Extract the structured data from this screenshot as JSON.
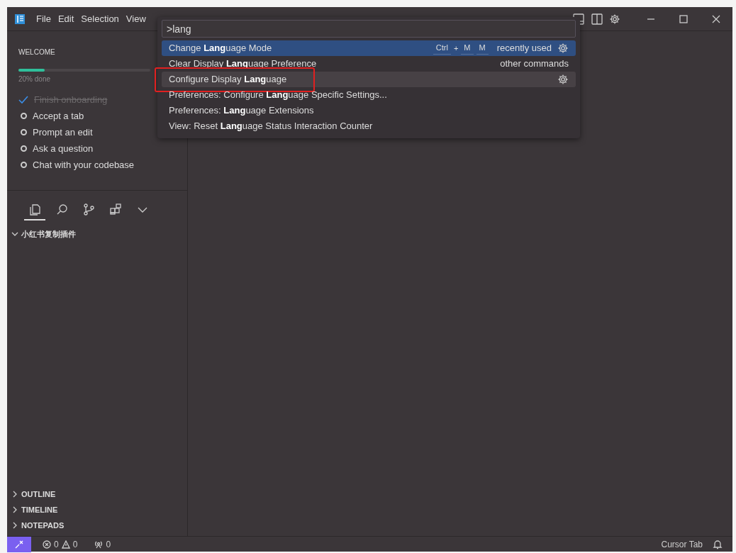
{
  "menu": [
    "File",
    "Edit",
    "Selection",
    "View"
  ],
  "palette": {
    "query": ">lang",
    "items": [
      {
        "label": "Change **Lang**uage Mode",
        "selected": true,
        "hovered": false,
        "annotated": false,
        "keybinding": [
          {
            "kind": "key",
            "text": "Ctrl"
          },
          {
            "kind": "sep",
            "text": "+"
          },
          {
            "kind": "key",
            "text": "M"
          },
          {
            "kind": "key",
            "text": "M"
          }
        ],
        "group": "recently used"
      },
      {
        "label": "Clear Display **Lang**uage Preference",
        "selected": false,
        "hovered": false,
        "annotated": false,
        "group": "other commands"
      },
      {
        "label": "Configure Display **Lang**uage",
        "selected": false,
        "hovered": true,
        "annotated": true
      },
      {
        "label": "Preferences: Configure **Lang**uage Specific Settings...",
        "selected": false,
        "hovered": false,
        "annotated": false
      },
      {
        "label": "Preferences: **Lang**uage Extensions",
        "selected": false,
        "hovered": false,
        "annotated": false
      },
      {
        "label": "View: Reset **Lang**uage Status Interaction Counter",
        "selected": false,
        "hovered": false,
        "annotated": false
      }
    ]
  },
  "welcome": {
    "title": "WELCOME",
    "progress": {
      "level": 0.2,
      "reading": "20% done"
    },
    "steps": [
      {
        "label": "Finish onboarding",
        "done": true
      },
      {
        "label": "Accept a tab",
        "done": false
      },
      {
        "label": "Prompt an edit",
        "done": false
      },
      {
        "label": "Ask a question",
        "done": false
      },
      {
        "label": "Chat with your codebase",
        "done": false
      }
    ]
  },
  "activity_bar": [
    {
      "kind": "files",
      "selected": true
    },
    {
      "kind": "search",
      "selected": false
    },
    {
      "kind": "source-control",
      "selected": false
    },
    {
      "kind": "extensions",
      "selected": false
    },
    {
      "kind": "more",
      "selected": false
    }
  ],
  "sidebar_sections": [
    {
      "title": "小红书复制插件",
      "expanded": true
    }
  ],
  "sidebar_bottom_sections": [
    {
      "title": "OUTLINE",
      "expanded": false
    },
    {
      "title": "TIMELINE",
      "expanded": false
    },
    {
      "title": "NOTEPADS",
      "expanded": false
    }
  ],
  "status_bar": {
    "errors": "0",
    "warnings": "0",
    "ports": "0",
    "right": "Cursor Tab"
  }
}
